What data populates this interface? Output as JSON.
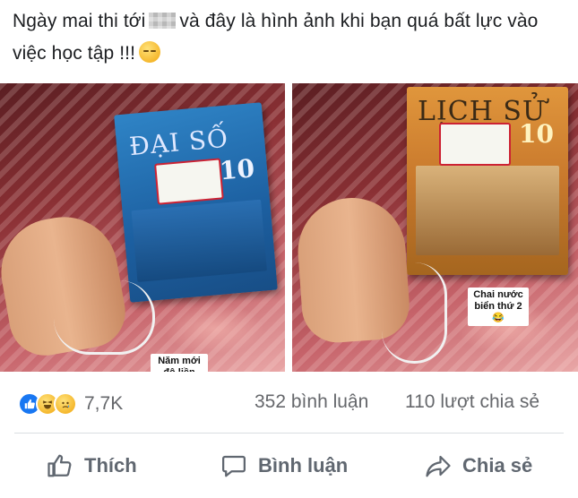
{
  "post": {
    "caption_part1": "Ngày mai thi tới",
    "caption_part2": "và đây là hình ảnh khi bạn quá bất lực vào việc học tập !!!"
  },
  "photos": [
    {
      "book_title": "ĐẠI SỐ",
      "book_number": "10",
      "sticker": "Năm mới đô liền"
    },
    {
      "book_title": "LỊCH SỬ",
      "book_number": "10",
      "sticker": "Chai nước biển thứ 2 😂"
    }
  ],
  "reactions": {
    "icons": [
      "like-icon",
      "haha-icon",
      "sad-icon"
    ],
    "count": "7,7K"
  },
  "stats": {
    "comments": "352 bình luận",
    "shares": "110 lượt chia sẻ"
  },
  "actions": {
    "like": "Thích",
    "comment": "Bình luận",
    "share": "Chia sẻ"
  },
  "colors": {
    "text": "#1c1e21",
    "muted": "#65676b",
    "action": "#606770",
    "like_blue": "#1877f2"
  }
}
